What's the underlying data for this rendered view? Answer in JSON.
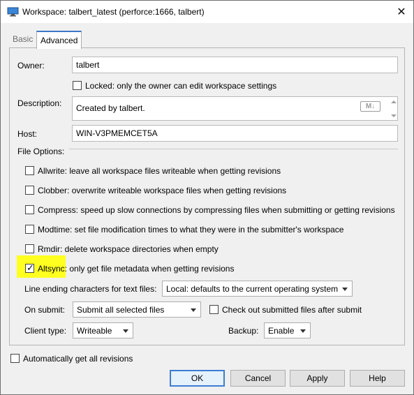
{
  "window": {
    "title": "Workspace: talbert_latest (perforce:1666,  talbert)",
    "icon": "monitor-icon"
  },
  "tabs": [
    {
      "label": "Basic",
      "active": false
    },
    {
      "label": "Advanced",
      "active": true
    }
  ],
  "owner": {
    "label": "Owner:",
    "value": "talbert"
  },
  "locked": {
    "label": "Locked: only the owner can edit workspace settings",
    "checked": false
  },
  "description": {
    "label": "Description:",
    "value": "Created by talbert.",
    "markdown_icon": "M↓"
  },
  "host": {
    "label": "Host:",
    "value": "WIN-V3PMEMCET5A"
  },
  "file_options": {
    "label": "File Options:",
    "options": [
      {
        "label": "Allwrite: leave all workspace files writeable when getting revisions",
        "checked": false
      },
      {
        "label": "Clobber: overwrite writeable workspace files when getting revisions",
        "checked": false
      },
      {
        "label": "Compress: speed up slow connections by compressing files when submitting or getting revisions",
        "checked": false
      },
      {
        "label": "Modtime: set file modification times to what they were in the submitter's workspace",
        "checked": false
      },
      {
        "label": "Rmdir: delete workspace directories when empty",
        "checked": false
      },
      {
        "label": "Altsync: only get file metadata when getting revisions",
        "checked": true
      }
    ]
  },
  "line_ending": {
    "label": "Line ending characters for text files:",
    "value": "Local: defaults to the current operating system"
  },
  "on_submit": {
    "label": "On submit:",
    "value": "Submit all selected files"
  },
  "checkout_after_submit": {
    "label": "Check out submitted files after submit",
    "checked": false
  },
  "client_type": {
    "label": "Client type:",
    "value": "Writeable"
  },
  "backup": {
    "label": "Backup:",
    "value": "Enable"
  },
  "auto_get": {
    "label": "Automatically get all revisions",
    "checked": false
  },
  "buttons": {
    "ok": "OK",
    "cancel": "Cancel",
    "apply": "Apply",
    "help": "Help"
  },
  "colors": {
    "highlight": "#ffff20",
    "accent": "#3c78c8"
  }
}
